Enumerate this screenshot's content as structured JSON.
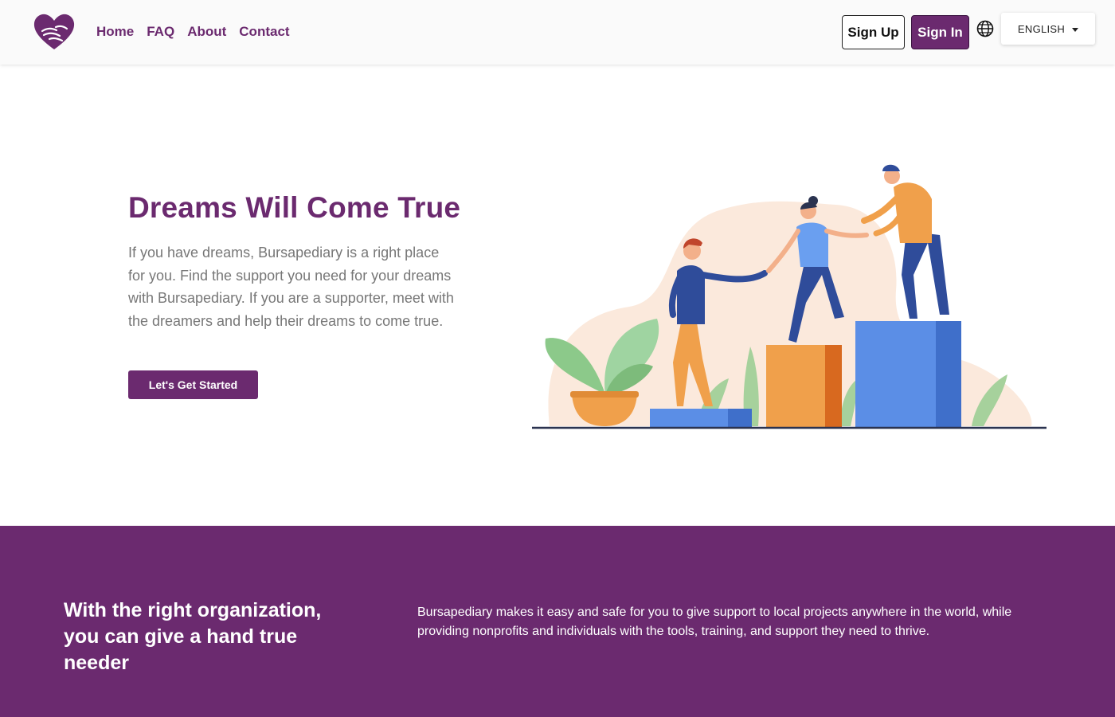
{
  "nav": {
    "links": [
      "Home",
      "FAQ",
      "About",
      "Contact"
    ],
    "signup_label": "Sign Up",
    "signin_label": "Sign In",
    "language": "ENGLISH"
  },
  "hero": {
    "title": "Dreams Will Come True",
    "text": "If you have dreams, Bursapediary is a right place for you. Find the support you need for your dreams with Bursapediary. If you are a supporter, meet with the dreamers and help their dreams to come true.",
    "cta_label": "Let's Get Started"
  },
  "band": {
    "heading": "With the right organization, you can give a hand true needer",
    "text": "Bursapediary makes it easy and safe for you to give support to local projects anywhere in the world, while providing nonprofits and individuals with the tools, training, and support they need to thrive."
  },
  "colors": {
    "brand": "#6b2a6f",
    "text_muted": "#777777"
  },
  "icons": [
    "heart-hands-logo-icon",
    "globe-icon",
    "caret-down-icon"
  ]
}
